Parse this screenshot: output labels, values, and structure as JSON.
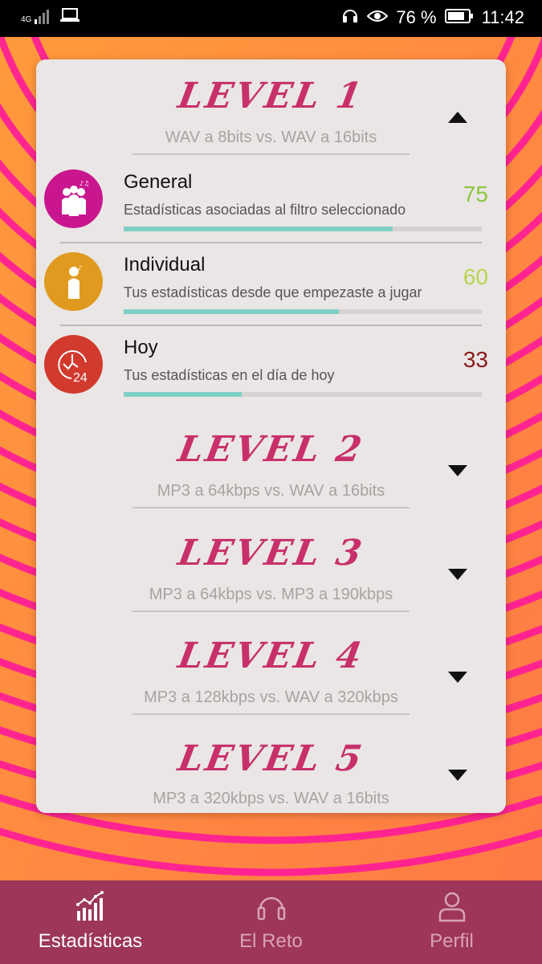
{
  "status_bar": {
    "network": "4G",
    "battery_percent": "76 %",
    "time": "11:42"
  },
  "levels": [
    {
      "title": "LEVEL 1",
      "subtitle": "WAV a 8bits vs. WAV a 16bits",
      "expanded": true
    },
    {
      "title": "LEVEL 2",
      "subtitle": "MP3 a 64kbps vs. WAV a 16bits",
      "expanded": false
    },
    {
      "title": "LEVEL 3",
      "subtitle": "MP3 a 64kbps vs. MP3 a 190kbps",
      "expanded": false
    },
    {
      "title": "LEVEL 4",
      "subtitle": "MP3 a 128kbps vs. WAV a 320kbps",
      "expanded": false
    },
    {
      "title": "LEVEL 5",
      "subtitle": "MP3 a 320kbps vs. WAV a 16bits",
      "expanded": false
    }
  ],
  "stats": [
    {
      "title": "General",
      "description": "Estadísticas asociadas al filtro seleccionado",
      "value": "75",
      "progress": 0.75,
      "icon": "group-icon",
      "icon_color": "#c9168f",
      "value_color": "#8cc63f"
    },
    {
      "title": "Individual",
      "description": "Tus estadísticas desde que empezaste a jugar",
      "value": "60",
      "progress": 0.6,
      "icon": "person-icon",
      "icon_color": "#e09a1f",
      "value_color": "#b8d451"
    },
    {
      "title": "Hoy",
      "description": "Tus estadísticas en el día de hoy",
      "value": "33",
      "progress": 0.33,
      "icon": "clock-24-icon",
      "icon_color": "#d23a2e",
      "value_color": "#8b1a1a"
    }
  ],
  "bottom_nav": [
    {
      "label": "Estadísticas",
      "icon": "stats-chart-icon",
      "active": true
    },
    {
      "label": "El Reto",
      "icon": "headphones-icon",
      "active": false
    },
    {
      "label": "Perfil",
      "icon": "user-icon",
      "active": false
    }
  ],
  "colors": {
    "accent": "#c8306a",
    "nav_background": "#9d3658",
    "progress_fill": "#7fcfc5"
  }
}
